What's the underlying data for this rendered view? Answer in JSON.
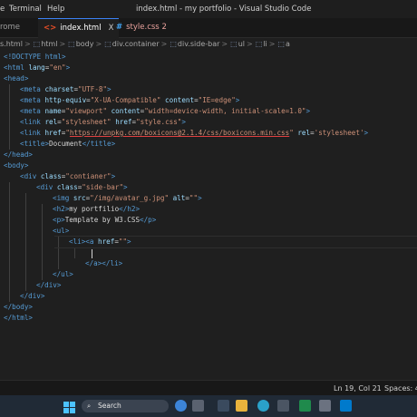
{
  "titlebar": {
    "menu_partial": "e",
    "menu_terminal": "Terminal",
    "menu_help": "Help",
    "title": "index.html - my portfolio - Visual Studio Code"
  },
  "tabs": {
    "partial": "rome",
    "index": {
      "icon": "html-icon",
      "label": "index.html",
      "close": "X"
    },
    "style": {
      "icon": "css-icon",
      "label": "style.css",
      "badge": "2"
    }
  },
  "breadcrumb": [
    "s.html",
    "html",
    "body",
    "div.container",
    "div.side-bar",
    "ul",
    "li",
    "a"
  ],
  "code": {
    "l1": "<!DOCTYPE html>",
    "l2_open": "<html ",
    "l2_attr": "lang",
    "l2_val": "\"en\"",
    "l3": "<head>",
    "l4": {
      "tag": "<meta ",
      "attr": "charset",
      "val": "\"UTF-8\"",
      "end": ">"
    },
    "l5": {
      "tag": "<meta ",
      "attr1": "http-equiv",
      "val1": "\"X-UA-Compatible\"",
      "attr2": "content",
      "val2": "\"IE=edge\"",
      "end": ">"
    },
    "l6": {
      "tag": "<meta ",
      "attr1": "name",
      "val1": "\"viewport\"",
      "attr2": "content",
      "val2": "\"width=device-width, initial-scale=1.0\"",
      "end": ">"
    },
    "l7": {
      "tag": "<link ",
      "attr1": "rel",
      "val1": "\"stylesheet\"",
      "attr2": "href",
      "val2": "\"style.css\"",
      "end": ">"
    },
    "l8": {
      "tag": "<link ",
      "attr1": "href",
      "val1_q": "\"",
      "val1_url": "https://unpkg.com/boxicons@2.1.4/css/boxicons.min.css",
      "val1_q2": "\"",
      "attr2": "rel",
      "val2": "'stylesheet'",
      "end": ">"
    },
    "l9": {
      "open": "<title>",
      "text": "Document",
      "close": "</title>"
    },
    "l10": "</head>",
    "l11": "<body>",
    "l12": {
      "tag": "<div ",
      "attr": "class",
      "val": "\"contianer\"",
      "end": ">"
    },
    "l13": {
      "tag": "<div ",
      "attr": "class",
      "val": "\"side-bar\"",
      "end": ">"
    },
    "l14": {
      "tag": "<img ",
      "attr1": "src",
      "val1": "\"/img/avatar_g.jpg\"",
      "attr2": "alt",
      "val2": "\"\"",
      "end": ">"
    },
    "l15": {
      "open": "<h2>",
      "text": "my portfilio",
      "close": "</h2>"
    },
    "l16": {
      "open": "<p>",
      "text": "Template by W3.CSS",
      "close": "</p>"
    },
    "l17": "<ul>",
    "l18": {
      "open_li": "<li>",
      "tag": "<a ",
      "attr": "href",
      "val": "\"\"",
      "end": ">"
    },
    "l19": "",
    "l20": {
      "close_a": "</a>",
      "close_li": "</li>"
    },
    "l21": "</ul>",
    "l22": "</div>",
    "l23": "</div>",
    "l24": "</body>",
    "l25": "</html>"
  },
  "statusbar": {
    "position": "Ln 19, Col 21",
    "spaces": "Spaces: 4"
  },
  "taskbar": {
    "search_label": "Search"
  },
  "colors": {
    "tag": "#569cd6",
    "attr": "#9cdcfe",
    "string": "#ce9178",
    "bracket": "#808080",
    "accent": "#3b82f6"
  }
}
